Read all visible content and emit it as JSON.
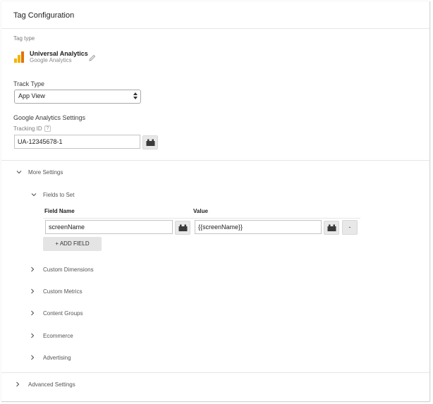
{
  "header": {
    "title": "Tag Configuration"
  },
  "tag_type": {
    "label": "Tag type",
    "name": "Universal Analytics",
    "vendor": "Google Analytics",
    "icon": "analytics-bars-icon",
    "icon_color": "#f4b400",
    "icon_color_dark": "#e37400",
    "edit_icon": "pencil-icon"
  },
  "track_type": {
    "label": "Track Type",
    "selected": "App View"
  },
  "ga_settings": {
    "label": "Google Analytics Settings",
    "tracking_id_label": "Tracking ID",
    "help_glyph": "?",
    "tracking_id_value": "UA-12345678-1"
  },
  "more_settings": {
    "label": "More Settings",
    "fields_to_set": {
      "label": "Fields to Set",
      "col_field_name": "Field Name",
      "col_value": "Value",
      "rows": [
        {
          "field_name": "screenName",
          "value": "{{screenName}}",
          "remove_label": "-"
        }
      ],
      "add_field_label": "+ ADD FIELD"
    },
    "sections": [
      "Custom Dimensions",
      "Custom Metrics",
      "Content Groups",
      "Ecommerce",
      "Advertising"
    ]
  },
  "advanced_settings": {
    "label": "Advanced Settings"
  }
}
